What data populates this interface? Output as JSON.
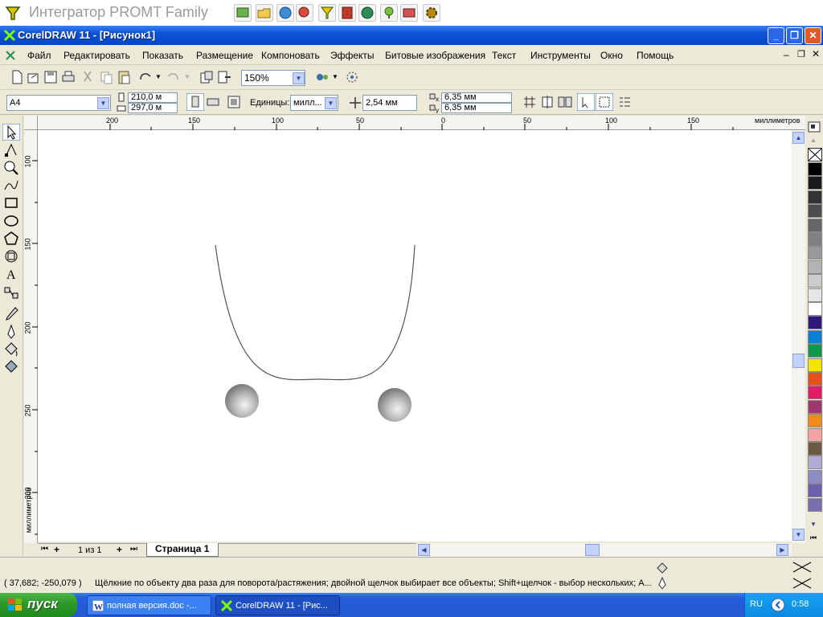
{
  "promt": {
    "title": "Интегратор PROMT Family"
  },
  "window": {
    "title": "CorelDRAW 11 - [Рисунок1]"
  },
  "menu": [
    "Файл",
    "Редактировать",
    "Показать",
    "Размещение",
    "Компоновать",
    "Эффекты",
    "Битовые изображения",
    "Текст",
    "Инструменты",
    "Окно",
    "Помощь"
  ],
  "toolbar": {
    "zoom": "150%"
  },
  "propbar": {
    "paper": "A4",
    "width": "210,0 м",
    "height": "297,0 м",
    "units_label": "Единицы:",
    "units_value": "милл...",
    "nudge": "2,54 мм",
    "dup_x": "6,35 мм",
    "dup_y": "6,35 мм"
  },
  "ruler": {
    "h_ticks": [
      "200",
      "150",
      "100",
      "50",
      "0",
      "50",
      "100",
      "150"
    ],
    "h_unit": "миллиметров",
    "v_ticks": [
      "100",
      "150",
      "200",
      "250",
      "300"
    ],
    "v_unit": "миллиметров"
  },
  "pagebar": {
    "count": "1 из 1",
    "tab": "Страница 1"
  },
  "status": {
    "coords": "( 37,682; -250,079 )",
    "hint": "Щёлкние по объекту два раза для поворота/растяжения; двойной щелчок выбирает все объекты; Shift+щелчок - выбор нескольких; A..."
  },
  "taskbar": {
    "start": "пуск",
    "tasks": [
      "полная версия.doc -...",
      "CorelDRAW 11 - [Рис..."
    ],
    "lang": "RU",
    "time": "0:58"
  },
  "palette_colors": [
    "#000000",
    "#1a1a1a",
    "#333333",
    "#4d4d4d",
    "#666666",
    "#808080",
    "#999999",
    "#b3b3b3",
    "#cccccc",
    "#e6e6e6",
    "#ffffff",
    "#2e1a7a",
    "#0a7fd6",
    "#0d9a4a",
    "#f5e400",
    "#e8501a",
    "#e6196b",
    "#a03870",
    "#f08a1c",
    "#f5a3a3",
    "#6b5a44",
    "#b0aad6",
    "#8c8cc4",
    "#6d5fb0",
    "#7a6fae"
  ]
}
